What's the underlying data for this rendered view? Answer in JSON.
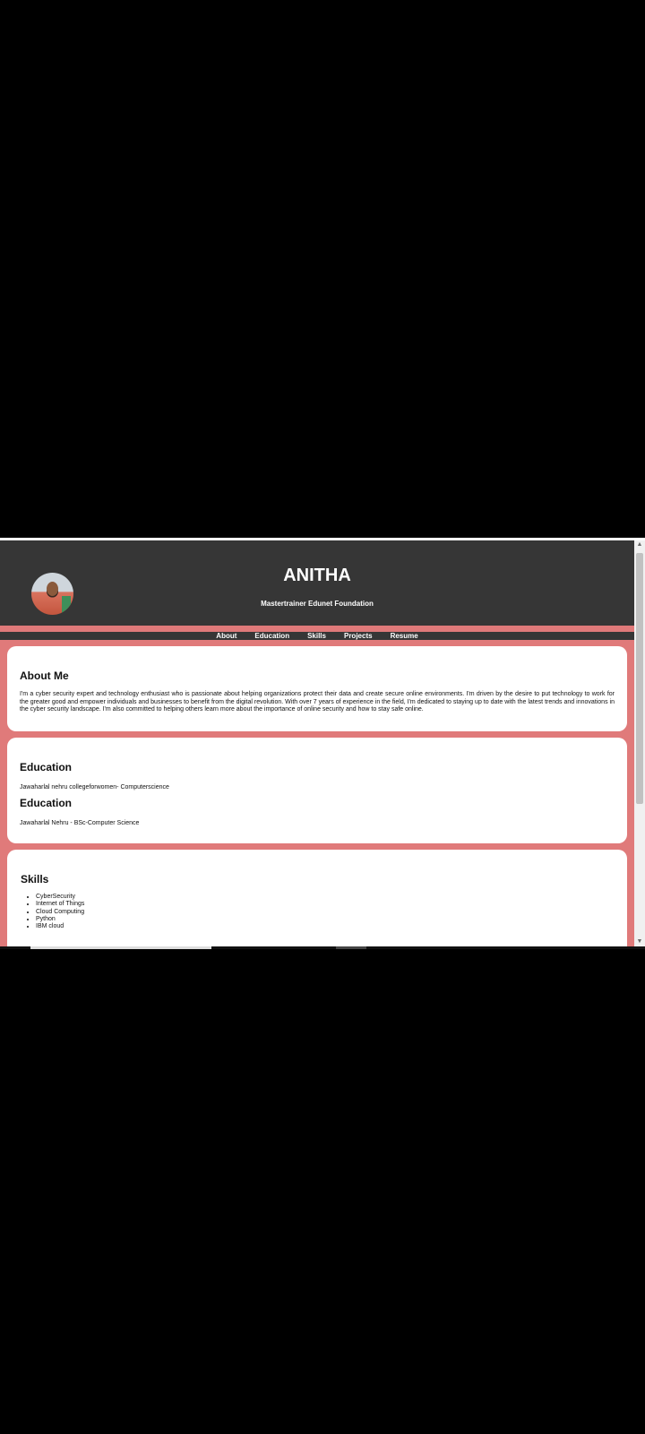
{
  "header": {
    "name": "ANITHA",
    "tagline": "Mastertrainer Edunet Foundation"
  },
  "nav": {
    "items": [
      "About",
      "Education",
      "Skills",
      "Projects",
      "Resume"
    ]
  },
  "about": {
    "title": "About Me",
    "text": "I'm a cyber security expert and technology enthusiast who is passionate about helping organizations protect their data and create secure online environments. I'm driven by the desire to put technology to work for the greater good and empower individuals and businesses to benefit from the digital revolution. With over 7 years of experience in the field, I'm dedicated to staying up to date with the latest trends and innovations in the cyber security landscape. I'm also committed to helping others learn more about the importance of online security and how to stay safe online."
  },
  "education": [
    {
      "title": "Education",
      "text": "Jawaharlal nehru collegeforwomen- Computerscience"
    },
    {
      "title": "Education",
      "text": "Jawaharlal Nehru - BSc-Computer Science"
    }
  ],
  "skills": {
    "title": "Skills",
    "items": [
      "CyberSecurity",
      "Internet of Things",
      "Cloud Computing",
      "Python",
      "IBM cloud"
    ]
  },
  "scrollbar": {
    "up_glyph": "▲",
    "down_glyph": "▼"
  },
  "colors": {
    "header_bg": "#363636",
    "page_bg": "#e07a7a",
    "card_bg": "#ffffff"
  }
}
